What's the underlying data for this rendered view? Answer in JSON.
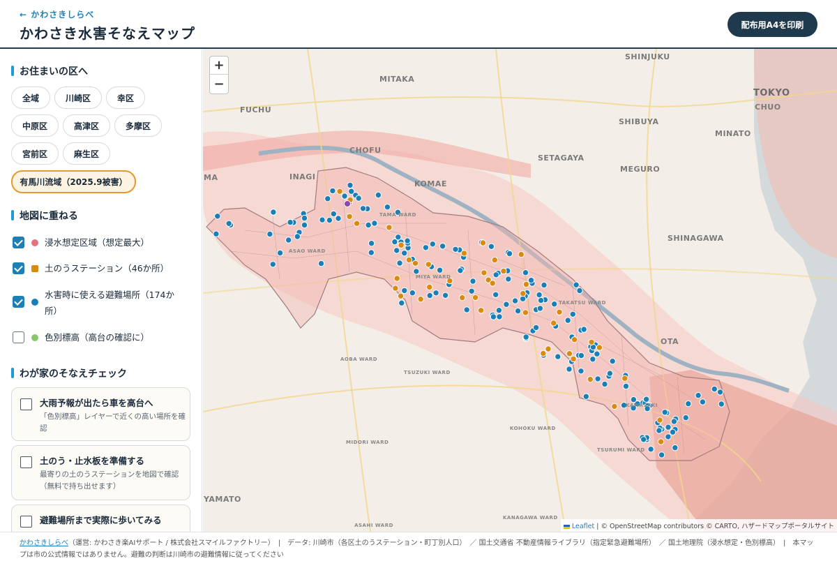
{
  "header": {
    "back_link": "← かわさきしらべ",
    "title": "かわさき水害そなえマップ",
    "print_button": "配布用A4を印刷"
  },
  "sidebar": {
    "ward_section_title": "お住まいの区へ",
    "wards": [
      {
        "label": "全域"
      },
      {
        "label": "川崎区"
      },
      {
        "label": "幸区"
      },
      {
        "label": "中原区"
      },
      {
        "label": "高津区"
      },
      {
        "label": "多摩区"
      },
      {
        "label": "宮前区"
      },
      {
        "label": "麻生区"
      }
    ],
    "arima_button": "有馬川流域（2025.9被害）",
    "layer_section_title": "地図に重ねる",
    "layers": [
      {
        "label": "浸水想定区域（想定最大）",
        "checked": true,
        "color": "#e2737a"
      },
      {
        "label": "土のうステーション（46か所）",
        "checked": true,
        "color": "#d98a10"
      },
      {
        "label": "水害時に使える避難場所（174か所）",
        "checked": true,
        "color": "#1a7fb6"
      },
      {
        "label": "色別標高（高台の確認に）",
        "checked": false,
        "color": "#8cc66a"
      }
    ],
    "check_section_title": "わが家のそなえチェック",
    "checks": [
      {
        "title": "大雨予報が出たら車を高台へ",
        "desc": "「色別標高」レイヤーで近くの高い場所を確認"
      },
      {
        "title": "土のう・止水板を準備する",
        "desc": "最寄りの土のうステーションを地図で確認（無料で持ち出せます）"
      },
      {
        "title": "避難場所まで実際に歩いてみる",
        "desc": ""
      }
    ]
  },
  "map": {
    "zoom_in": "+",
    "zoom_out": "−",
    "labels": {
      "shinjuku": "SHINJUKU",
      "mitaka": "MITAKA",
      "fuchu": "FUCHU",
      "shibuya": "SHIBUYA",
      "tokyo": "TOKYO",
      "chuo": "CHUO",
      "minato": "MINATO",
      "chofu": "CHOFU",
      "setagaya": "SETAGAYA",
      "meguro": "MEGURO",
      "inagi": "INAGI",
      "komae": "KOMAE",
      "shinagawa": "SHINAGAWA",
      "ota": "OTA",
      "yamato": "YAMATO",
      "ma": "MA",
      "aoba": "AOBA WARD",
      "tsuzuki": "TSUZUKI WARD",
      "kohoku": "KOHOKU WARD",
      "midori": "MIDORI WARD",
      "tsurumi": "TSURUMI WARD",
      "asahi": "ASAHI WARD",
      "kanagawa": "KANAGAWA WARD",
      "asao": "ASAO WARD",
      "tama": "TAMA WARD",
      "miya": "MIYA WARD",
      "takatsu": "TAKATSU WARD",
      "kawasaki": "KAWASAKI"
    },
    "attribution_leaflet": "Leaflet",
    "attribution_rest": "| © OpenStreetMap contributors © CARTO, ハザードマップポータルサイト",
    "colors": {
      "shelter": "#1a7fb6",
      "sandbag": "#d98a10",
      "flood": "#f4a3a0"
    }
  },
  "footer": {
    "link": "かわさきしらべ",
    "text": "（運営: かわさき楽AIサポート / 株式会社スマイルファクトリー）　|　データ: 川崎市（各区土のうステーション・町丁別人口）　／ 国土交通省 不動産情報ライブラリ（指定緊急避難場所）　／ 国土地理院（浸水想定・色別標高）　|　本マップは市の公式情報ではありません。避難の判断は川崎市の避難情報に従ってください"
  }
}
